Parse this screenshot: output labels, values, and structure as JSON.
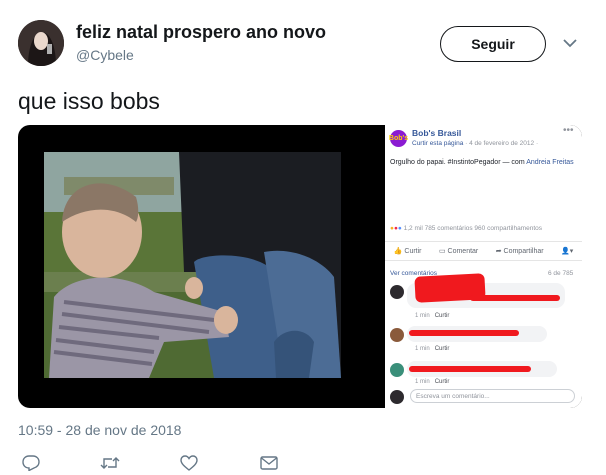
{
  "tweet": {
    "display_name": "feliz natal prospero ano novo",
    "handle": "@Cybele",
    "follow_label": "Seguir",
    "text": "que isso bobs",
    "timestamp": "10:59 - 28 de nov de 2018"
  },
  "facebook": {
    "logo_text": "Bob's",
    "page_name": "Bob's Brasil",
    "like_page": "Curtir esta página",
    "date": "· 4 de fevereiro de 2012 ·",
    "post_text": "Orgulho do papai. #InstintoPegador",
    "post_with": "— com",
    "post_tag": "Andreia Freitas",
    "reactions": "1,2 mil   785 comentários   960 compartilhamentos",
    "actions": [
      "Curtir",
      "Comentar",
      "Compartilhar"
    ],
    "see_more": "Ver comentários",
    "comment_count": "6 de 785",
    "comments": [
      {
        "time": "1 min",
        "like": "Curtir"
      },
      {
        "time": "1 min",
        "like": "Curtir"
      },
      {
        "time": "1 min",
        "like": "Curtir"
      }
    ],
    "input_placeholder": "Escreva um comentário..."
  },
  "icons": [
    "chevron-down-icon",
    "reply-icon",
    "retweet-icon",
    "like-icon",
    "message-icon"
  ],
  "colors": {
    "text": "#14171a",
    "muted": "#657786",
    "fb_blue": "#365899",
    "bobs_purple": "#8b1bd2",
    "redaction": "#f0191e"
  }
}
